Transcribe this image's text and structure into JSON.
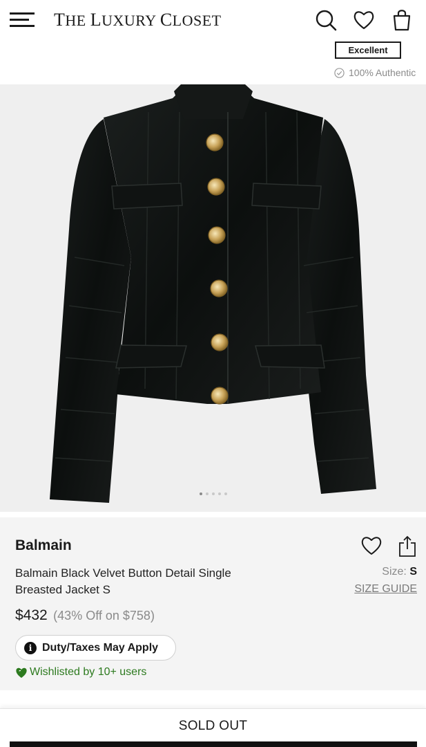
{
  "header": {
    "logo": {
      "part1": "T",
      "part2": "HE ",
      "part3": "L",
      "part4": "UXURY ",
      "part5": "C",
      "part6": "LOSET"
    },
    "icons": [
      "menu-icon",
      "search-icon",
      "heart-icon",
      "shopping-bag-icon"
    ]
  },
  "condition": {
    "badge": "Excellent",
    "authentic": "100% Authentic"
  },
  "gallery": {
    "image_alt": "Black velvet jacket with gold buttons",
    "slides": 5,
    "active_slide": 1
  },
  "product": {
    "brand": "Balmain",
    "title": "Balmain Black Velvet Button Detail Single Breasted Jacket S",
    "size_label": "Size:",
    "size_value": "S",
    "size_guide": "SIZE GUIDE",
    "price": "$432",
    "discount": "(43% Off on $758)",
    "duty": "Duty/Taxes May Apply",
    "wishlisted": "Wishlisted by 10+ users"
  },
  "cta": {
    "label": "SOLD OUT"
  },
  "colors": {
    "wishlist_green": "#2d7a1f",
    "image_bg": "#efefef",
    "info_bg": "#f4f4f4"
  }
}
